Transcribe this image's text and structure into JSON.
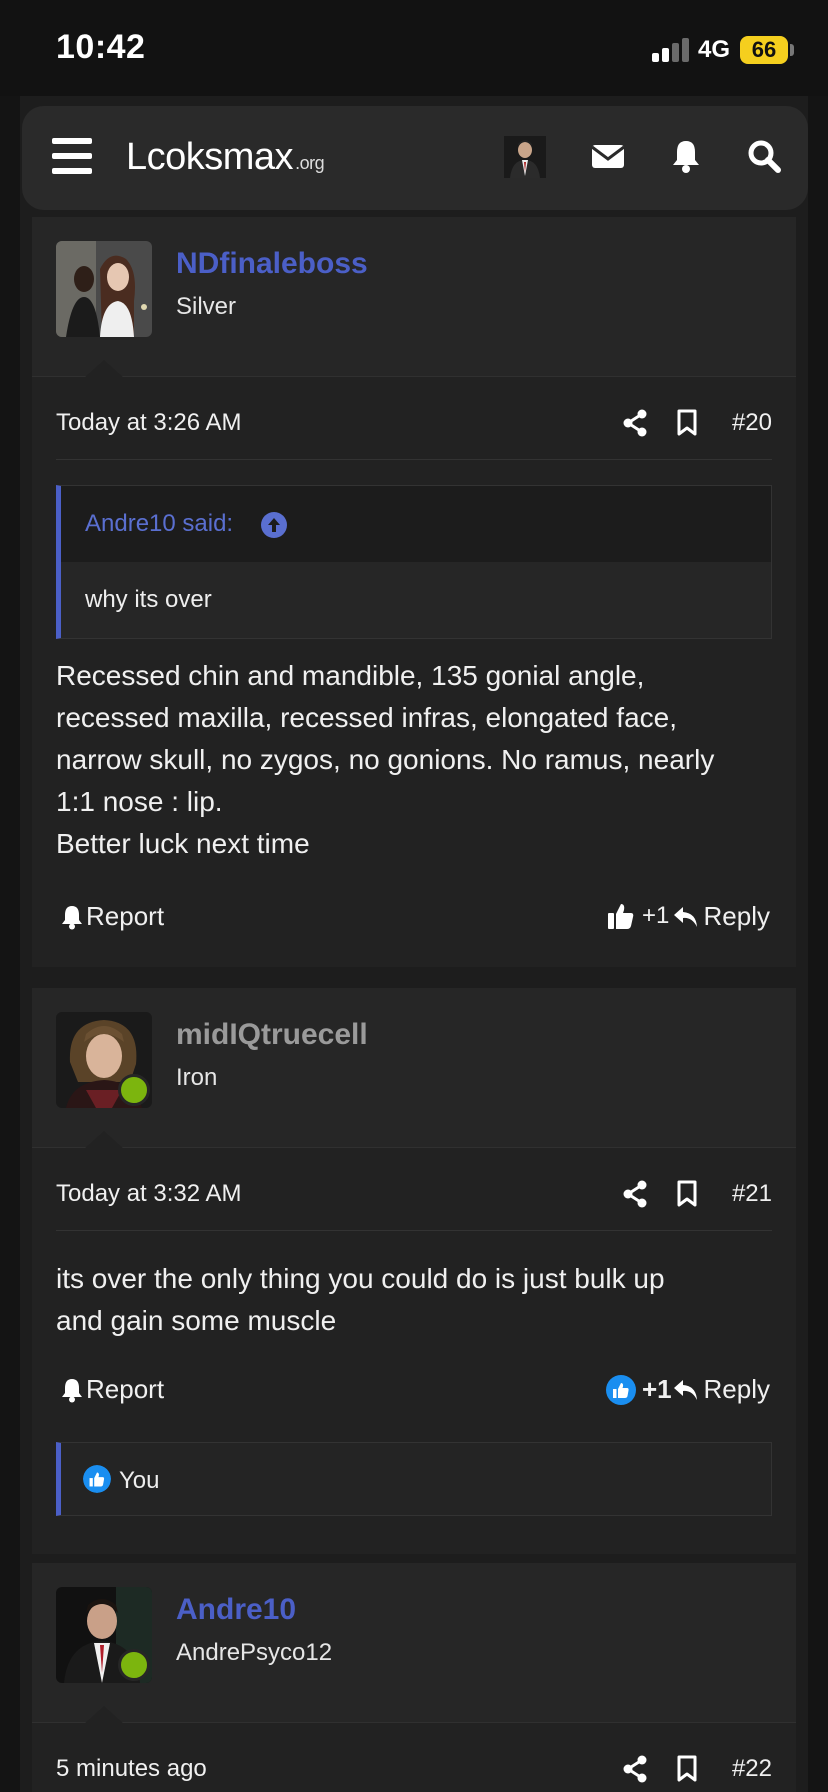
{
  "status_bar": {
    "time": "10:42",
    "network": "4G",
    "battery": "66"
  },
  "header": {
    "logo": "Lcoksmax",
    "logo_suffix": ".org",
    "icons": [
      "menu-icon",
      "avatar",
      "mail-icon",
      "bell-icon",
      "search-icon"
    ]
  },
  "posts": [
    {
      "username": "NDfinaleboss",
      "user_title": "Silver",
      "online": false,
      "date": "Today at 3:26 AM",
      "number": "#20",
      "quote": {
        "author": "Andre10 said:",
        "text": "why its over"
      },
      "body": [
        "Recessed chin and mandible, 135 gonial angle,",
        "recessed maxilla, recessed infras, elongated face,",
        "narrow skull, no zygos, no gonions. No ramus, nearly",
        "1:1 nose : lip.",
        "Better luck next time"
      ],
      "report_label": "Report",
      "likes": "+1",
      "reply_label": "Reply"
    },
    {
      "username": "midIQtruecell",
      "user_title": "Iron",
      "online": true,
      "date": "Today at 3:32 AM",
      "number": "#21",
      "body": [
        "its over the only thing you could do is just bulk up",
        "and gain some muscle"
      ],
      "report_label": "Report",
      "likes": "+1",
      "reply_label": "Reply",
      "reactions": "You"
    },
    {
      "username": "Andre10",
      "user_title": "AndrePsyco12",
      "online": true,
      "date": "5 minutes ago",
      "number": "#22"
    }
  ],
  "colors": {
    "accent": "#4b5fc7",
    "online": "#7cb50e",
    "like": "#1a8ef0",
    "battery": "#f5cf1e"
  }
}
